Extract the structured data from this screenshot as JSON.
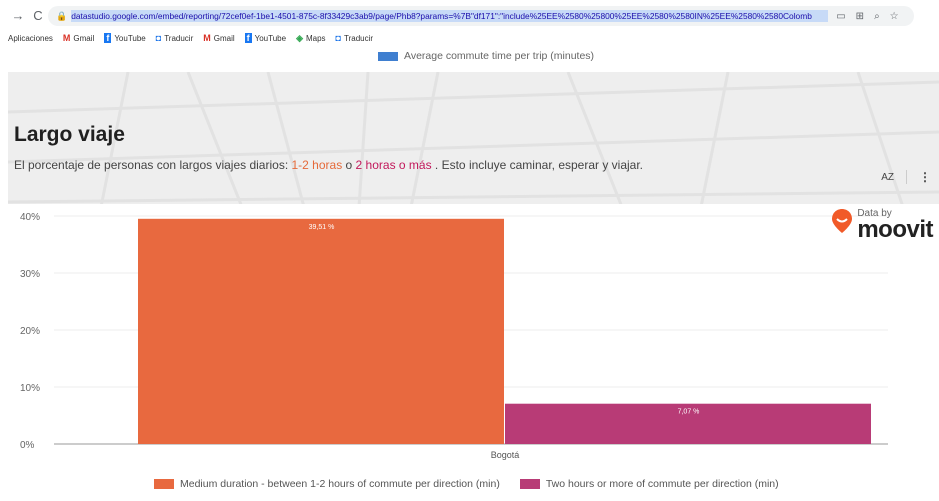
{
  "browser": {
    "back_icon": "←",
    "forward_icon": "→",
    "reload_icon": "C",
    "url": "datastudio.google.com/embed/reporting/72cef0ef-1be1-4501-875c-8f33429c3ab9/page/Phb8?params=%7B\"df171\":\"include%25EE%2580%25800%25EE%2580%2580IN%25EE%2580%2580Colomb"
  },
  "bookmarks": [
    {
      "label": "Aplicaciones",
      "icon": ""
    },
    {
      "label": "Gmail",
      "icon": "M"
    },
    {
      "label": "YouTube",
      "icon": "f"
    },
    {
      "label": "Traducir",
      "icon": "◘"
    },
    {
      "label": "Gmail",
      "icon": "M"
    },
    {
      "label": "YouTube",
      "icon": "f"
    },
    {
      "label": "Maps",
      "icon": "◈"
    },
    {
      "label": "Traducir",
      "icon": "◘"
    }
  ],
  "top_legend": {
    "label": "Average commute time per trip (minutes)",
    "color": "#3f7fd0"
  },
  "section": {
    "title": "Largo viaje",
    "subtitle_pre": "El porcentaje de personas con largos viajes diarios: ",
    "subtitle_hl1": "1-2 horas",
    "subtitle_mid": " o ",
    "subtitle_hl2": "2 horas o más",
    "subtitle_post": " . Esto incluye caminar, esperar y viajar."
  },
  "tools": {
    "sort_icon": "AZ",
    "more_icon": "⋮"
  },
  "branding": {
    "data_by": "Data by",
    "brand": "moovit"
  },
  "chart_data": {
    "type": "bar",
    "categories": [
      "Bogotá"
    ],
    "series": [
      {
        "name": "Medium duration - between 1-2 hours of commute per direction (min)",
        "values": [
          39.51
        ],
        "label": "39,51 %",
        "color": "#e8693f"
      },
      {
        "name": "Two hours or more of commute per direction (min)",
        "values": [
          7.07
        ],
        "label": "7,07 %",
        "color": "#b83b76"
      }
    ],
    "ylim": [
      0,
      40
    ],
    "yticks": [
      "0%",
      "10%",
      "20%",
      "30%",
      "40%"
    ],
    "grid": true,
    "legend": "bottom"
  }
}
